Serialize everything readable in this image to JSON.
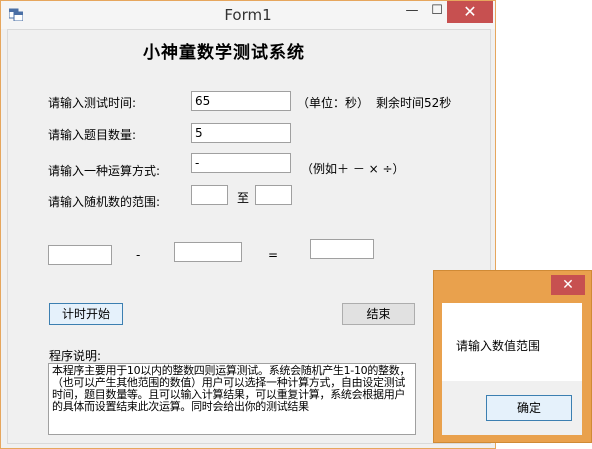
{
  "window": {
    "title": "Form1",
    "minimize": "—",
    "maximize": "☐",
    "close": "✕"
  },
  "form": {
    "heading": "小神童数学测试系统",
    "time_label": "请输入测试时间:",
    "time_value": "65",
    "unit_hint": "（单位：秒）",
    "remaining": "剩余时间52秒",
    "count_label": "请输入题目数量:",
    "count_value": "5",
    "op_label": "请输入一种运算方式:",
    "op_value": "-",
    "op_hint": "（例如＋  －  ×  ÷）",
    "range_label": "请输入随机数的范围:",
    "range_min": "",
    "range_to": "至",
    "range_max": "",
    "operand1": "",
    "operator_sign": "-",
    "operand2": "",
    "equals_sign": "=",
    "result": "",
    "start_button": "计时开始",
    "end_button": "结束",
    "desc_label": "程序说明:",
    "description": "本程序主要用于10以内的整数四则运算测试。系统会随机产生1-10的整数，（也可以产生其他范围的数值）用户可以选择一种计算方式，自由设定测试时间，题目数量等。且可以输入计算结果，可以重复计算，系统会根据用户的具体而设置结束此次运算。同时会给出你的测试结果"
  },
  "dialog": {
    "close": "✕",
    "message": "请输入数值范围",
    "ok_button": "确定"
  },
  "colors": {
    "accent_border": "#e6a65d",
    "close_red": "#c75050",
    "dialog_frame": "#e9a14d"
  }
}
